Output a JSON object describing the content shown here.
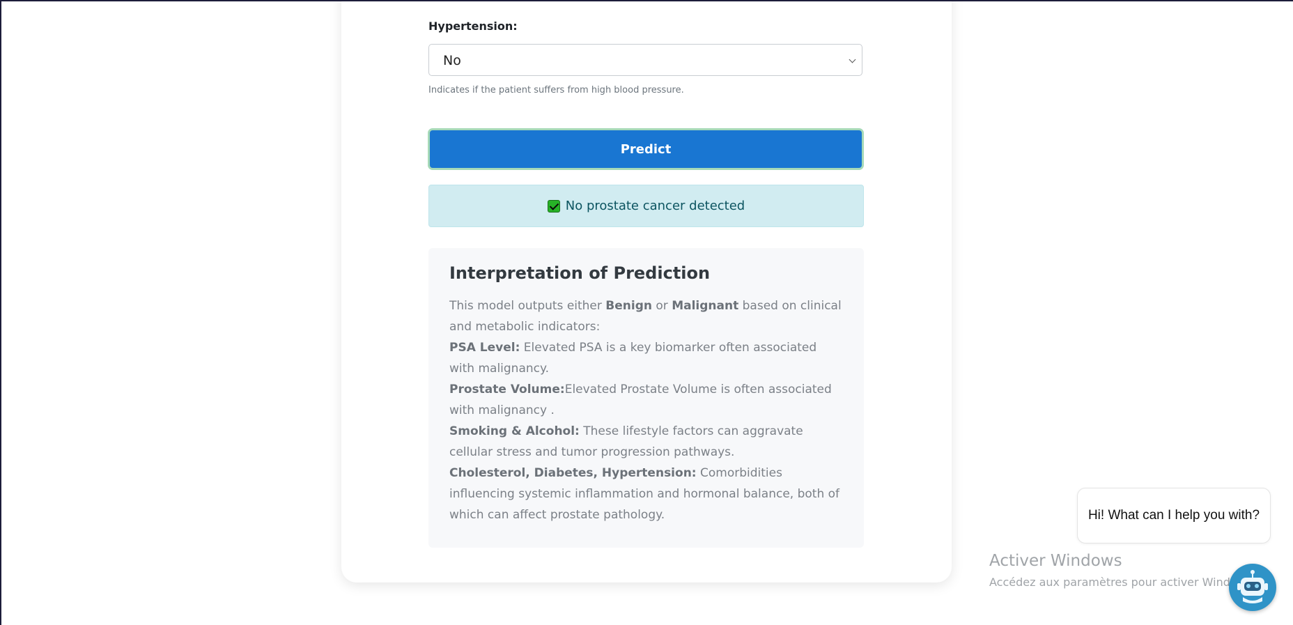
{
  "form": {
    "hypertension_label": "Hypertension:",
    "hypertension_value": "No",
    "hypertension_hint": "Indicates if the patient suffers from high blood pressure.",
    "predict_label": "Predict"
  },
  "result": {
    "icon": "check-box-icon",
    "text": "No prostate cancer detected"
  },
  "interpretation": {
    "title": "Interpretation of Prediction",
    "intro_pre": "This model outputs either ",
    "benign": "Benign",
    "or": " or ",
    "malignant": "Malignant",
    "intro_post": " based on clinical and metabolic indicators:",
    "psa_label": "PSA Level:",
    "psa_text": " Elevated PSA is a key biomarker often associated with malignancy.",
    "volume_label": "Prostate Volume:",
    "volume_text": "Elevated Prostate Volume is often associated with malignancy .",
    "lifestyle_label": "Smoking & Alcohol:",
    "lifestyle_text": " These lifestyle factors can aggravate cellular stress and tumor progression pathways.",
    "comorb_label": "Cholesterol, Diabetes, Hypertension:",
    "comorb_text": " Comorbidities influencing systemic inflammation and hormonal balance, both of which can affect prostate pathology."
  },
  "chat": {
    "greeting": "Hi! What can I help you with?",
    "bot_icon": "robot-icon"
  },
  "watermark": {
    "title": "Activer Windows",
    "subtitle": "Accédez aux paramètres pour activer Windows."
  },
  "colors": {
    "predict_bg": "#1976d2",
    "result_bg": "#d1ecf1",
    "result_text": "#0c5460",
    "bot_bg": "#2f93c7"
  }
}
